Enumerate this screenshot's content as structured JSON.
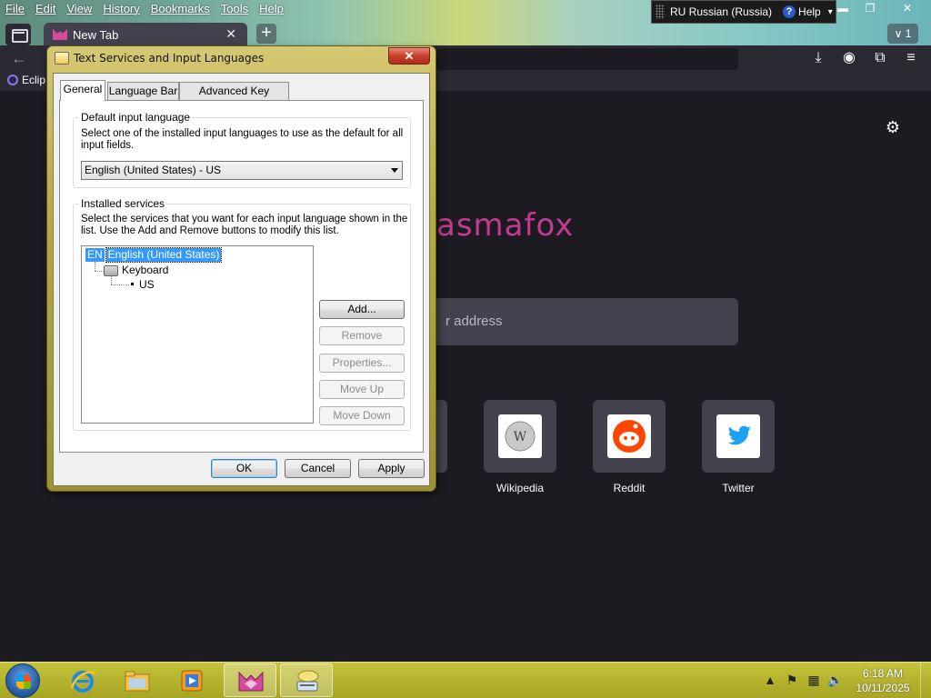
{
  "browser": {
    "menu": [
      "File",
      "Edit",
      "View",
      "History",
      "Bookmarks",
      "Tools",
      "Help"
    ],
    "tab_title": "New Tab",
    "tab_count": "1",
    "bookmark": "Eclip",
    "brand": "asmafox",
    "search_placeholder": "r address",
    "shortcuts": [
      {
        "label": "Wikipedia"
      },
      {
        "label": "Reddit"
      },
      {
        "label": "Twitter"
      }
    ],
    "colors": {
      "brand": "#c23a8f",
      "toolbar": "#2b2a33",
      "page": "#1c1b22"
    }
  },
  "language_bar": {
    "language": "RU Russian (Russia)",
    "help": "Help"
  },
  "dialog": {
    "title": "Text Services and Input Languages",
    "tabs": [
      "General",
      "Language Bar",
      "Advanced Key Settings"
    ],
    "default_group": {
      "legend": "Default input language",
      "desc": "Select one of the installed input languages to use as the default for all input fields.",
      "selected": "English (United States) - US"
    },
    "installed_group": {
      "legend": "Installed services",
      "desc": "Select the services that you want for each input language shown in the list. Use the Add and Remove buttons to modify this list.",
      "tree": {
        "code": "EN",
        "language": "English (United States)",
        "category": "Keyboard",
        "layout": "US"
      },
      "buttons": [
        "Add...",
        "Remove",
        "Properties...",
        "Move Up",
        "Move Down"
      ]
    },
    "footer_buttons": [
      "OK",
      "Cancel",
      "Apply"
    ]
  },
  "taskbar": {
    "time": "6:18 AM",
    "date": "10/11/2025"
  }
}
